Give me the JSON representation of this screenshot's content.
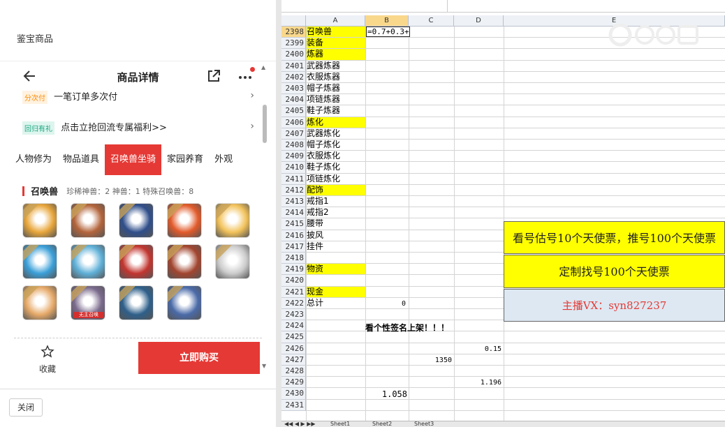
{
  "left": {
    "header_title": "鉴宝商品",
    "nav_title": "商品详情",
    "promo1_tag": "分次付",
    "promo1_text": "一笔订单多次付",
    "promo2_tag": "回归有礼",
    "promo2_text": "点击立抢回流专属福利>>",
    "tabs": [
      "人物修为",
      "物品道具",
      "召唤兽坐骑",
      "家园养育",
      "外观"
    ],
    "section_title": "召唤兽",
    "section_counts": "珍稀神兽：2  神兽：1  特殊召唤兽：8",
    "pets": [
      {
        "color": "#e8a63a",
        "label": ""
      },
      {
        "color": "#b3643b",
        "label": ""
      },
      {
        "color": "#2f4e8a",
        "label": ""
      },
      {
        "color": "#e25a2a",
        "label": ""
      },
      {
        "color": "#f2c25a",
        "label": ""
      },
      {
        "color": "#3a9fd8",
        "label": ""
      },
      {
        "color": "#5fb0d8",
        "label": ""
      },
      {
        "color": "#c2352f",
        "label": ""
      },
      {
        "color": "#a2452f",
        "label": ""
      },
      {
        "color": "#cccccc",
        "label": ""
      },
      {
        "color": "#e6a968",
        "label": ""
      },
      {
        "color": "#7a6a8c",
        "label": "无主召唤"
      },
      {
        "color": "#2e5f8a",
        "label": ""
      },
      {
        "color": "#4a6aa8",
        "label": ""
      }
    ],
    "fav_label": "收藏",
    "buy_label": "立即购买",
    "close_label": "关闭"
  },
  "excel": {
    "formula_edit": "=0.7+0.3+",
    "columns": [
      "A",
      "B",
      "C",
      "D",
      "E"
    ],
    "rows": [
      {
        "n": "2398",
        "a": "召唤兽",
        "y": true
      },
      {
        "n": "2399",
        "a": "装备",
        "y": true
      },
      {
        "n": "2400",
        "a": "炼器",
        "y": true
      },
      {
        "n": "2401",
        "a": "武器炼器",
        "y": false
      },
      {
        "n": "2402",
        "a": "衣服炼器",
        "y": false
      },
      {
        "n": "2403",
        "a": "帽子炼器",
        "y": false
      },
      {
        "n": "2404",
        "a": "项链炼器",
        "y": false
      },
      {
        "n": "2405",
        "a": "鞋子炼器",
        "y": false
      },
      {
        "n": "2406",
        "a": "炼化",
        "y": true
      },
      {
        "n": "2407",
        "a": "武器炼化",
        "y": false
      },
      {
        "n": "2408",
        "a": "帽子炼化",
        "y": false
      },
      {
        "n": "2409",
        "a": "衣服炼化",
        "y": false
      },
      {
        "n": "2410",
        "a": "鞋子炼化",
        "y": false
      },
      {
        "n": "2411",
        "a": "项链炼化",
        "y": false
      },
      {
        "n": "2412",
        "a": "配饰",
        "y": true
      },
      {
        "n": "2413",
        "a": "戒指1",
        "y": false
      },
      {
        "n": "2414",
        "a": "戒指2",
        "y": false
      },
      {
        "n": "2415",
        "a": "腰带",
        "y": false
      },
      {
        "n": "2416",
        "a": "披风",
        "y": false
      },
      {
        "n": "2417",
        "a": "挂件",
        "y": false
      },
      {
        "n": "2418",
        "a": "",
        "y": false
      },
      {
        "n": "2419",
        "a": "物资",
        "y": true
      },
      {
        "n": "2420",
        "a": "",
        "y": false
      },
      {
        "n": "2421",
        "a": "现金",
        "y": true
      },
      {
        "n": "2422",
        "a": "总计",
        "y": false
      },
      {
        "n": "2423",
        "a": "",
        "y": false
      },
      {
        "n": "2424",
        "a": "",
        "y": false
      },
      {
        "n": "2425",
        "a": "",
        "y": false
      },
      {
        "n": "2426",
        "a": "",
        "y": false
      },
      {
        "n": "2427",
        "a": "",
        "y": false
      },
      {
        "n": "2428",
        "a": "",
        "y": false
      },
      {
        "n": "2429",
        "a": "",
        "y": false
      },
      {
        "n": "2430",
        "a": "",
        "y": false
      },
      {
        "n": "2431",
        "a": "",
        "y": false
      }
    ],
    "total_value": "0",
    "banner_2424": "看个性签名上架！！！",
    "d2426": "0.15",
    "c2427": "1350",
    "d2429": "1.196",
    "b2430": "1.058",
    "box1": "看号估号10个天使票，推号100个天使票",
    "box2": "定制找号100个天使票",
    "box3": "主播VX：syn827237",
    "box_yellow": "#ffff00",
    "box_blue": "#dde8f2",
    "box3_color": "#e53935",
    "sheet_tabs": [
      "Sheet1",
      "Sheet2",
      "Sheet3"
    ]
  }
}
